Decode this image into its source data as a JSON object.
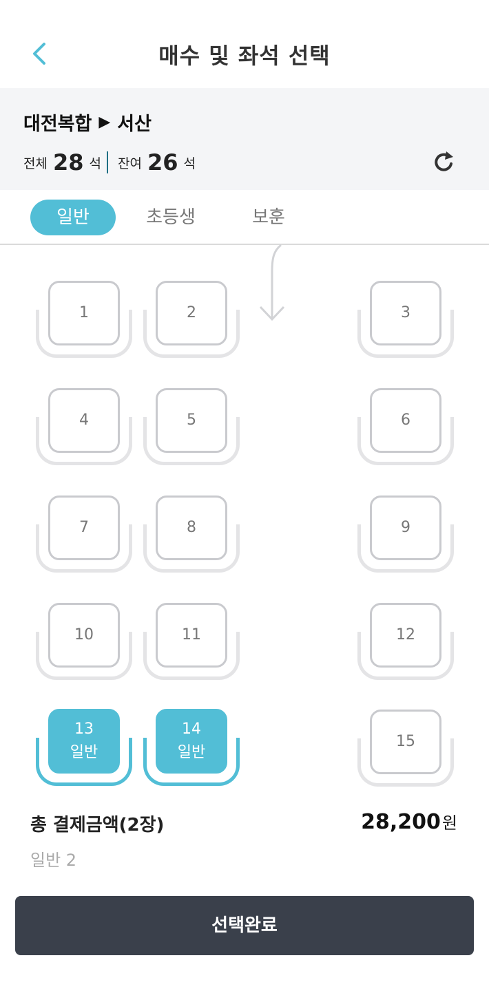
{
  "header": {
    "title": "매수 및 좌석 선택",
    "back_icon": "chevron-left-icon"
  },
  "route": {
    "departure": "대전복합",
    "arrow": "▶",
    "arrival": "서산"
  },
  "counts": {
    "total_label": "전체",
    "total_value": "28",
    "total_unit": "석",
    "remaining_label": "잔여",
    "remaining_value": "26",
    "remaining_unit": "석"
  },
  "tabs": [
    {
      "label": "일반",
      "active": true
    },
    {
      "label": "초등생",
      "active": false
    },
    {
      "label": "보훈",
      "active": false
    }
  ],
  "seats": [
    {
      "number": "1"
    },
    {
      "number": "2"
    },
    {
      "number": "3"
    },
    {
      "number": "4"
    },
    {
      "number": "5"
    },
    {
      "number": "6"
    },
    {
      "number": "7"
    },
    {
      "number": "8"
    },
    {
      "number": "9"
    },
    {
      "number": "10"
    },
    {
      "number": "11"
    },
    {
      "number": "12"
    },
    {
      "number": "13",
      "type": "일반",
      "selected": true
    },
    {
      "number": "14",
      "type": "일반",
      "selected": true
    },
    {
      "number": "15"
    }
  ],
  "summary": {
    "total_label": "총 결제금액(2장)",
    "price": "28,200",
    "price_unit": "원",
    "detail": "일반 2"
  },
  "confirm_button": "선택완료",
  "colors": {
    "accent": "#52bed6",
    "button_dark": "#3a404b",
    "panel_bg": "#f4f5f7"
  }
}
